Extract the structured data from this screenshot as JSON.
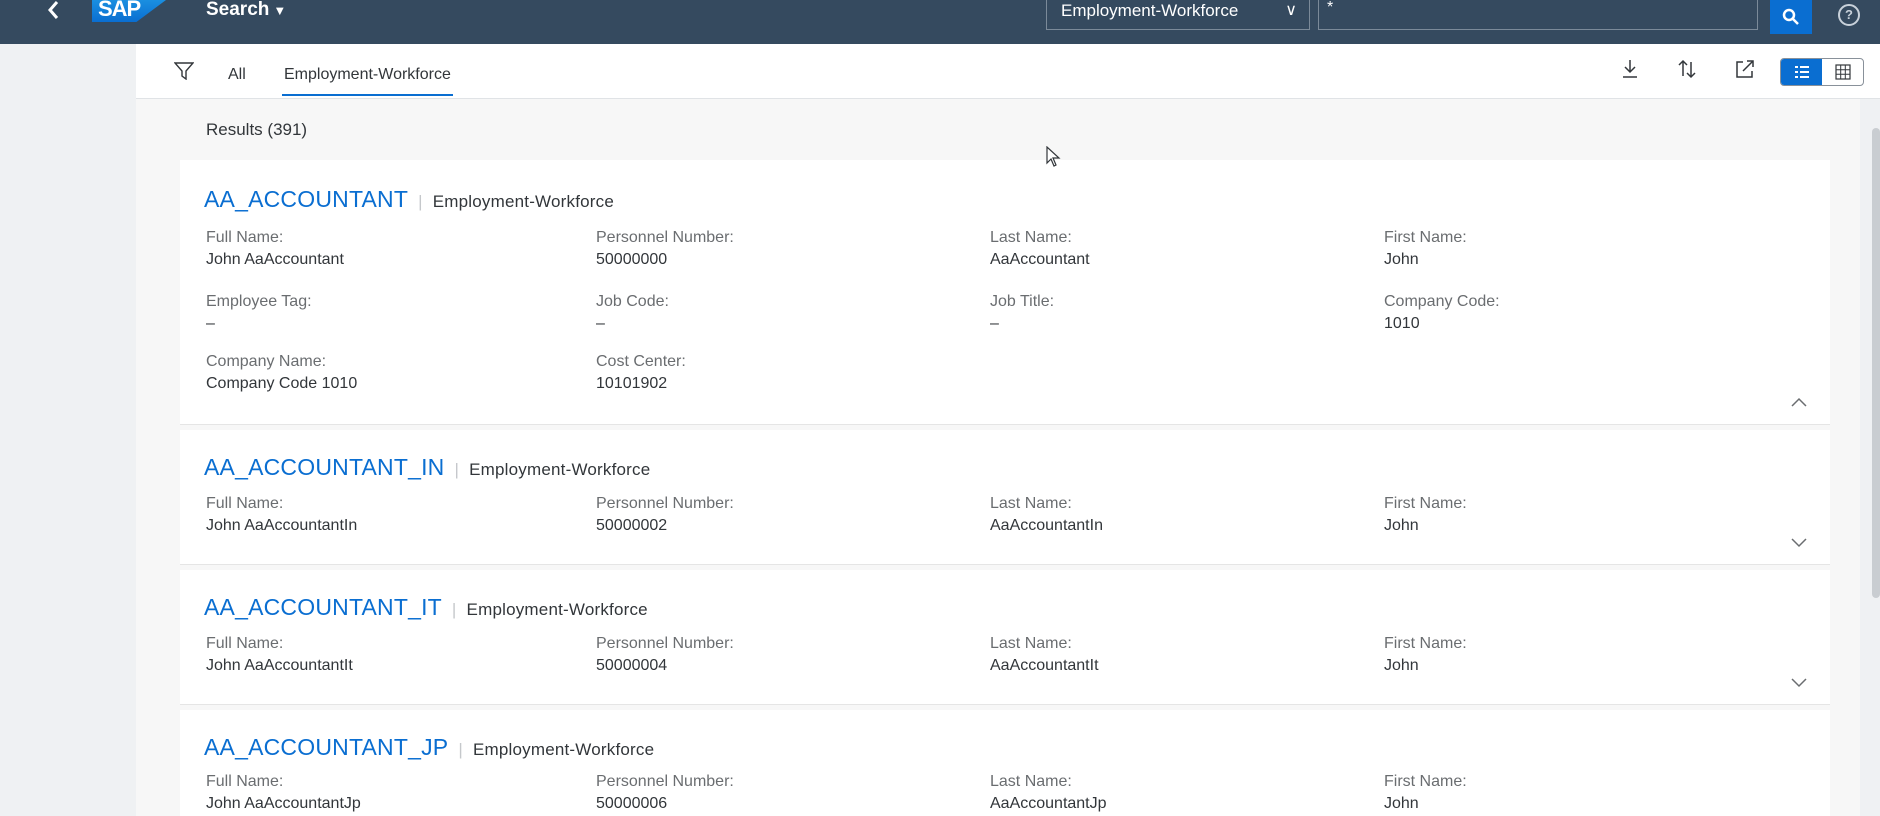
{
  "shell": {
    "logo": "SAP",
    "search_label": "Search",
    "scope": "Employment-Workforce",
    "search_value": "*",
    "help": "?"
  },
  "tabs": [
    {
      "label": "All"
    },
    {
      "label": "Employment-Workforce"
    }
  ],
  "results_count": "Results (391)",
  "labels": {
    "full_name": "Full Name:",
    "personnel_number": "Personnel Number:",
    "last_name": "Last Name:",
    "first_name": "First Name:",
    "employee_tag": "Employee Tag:",
    "job_code": "Job Code:",
    "job_title": "Job Title:",
    "company_code": "Company Code:",
    "company_name": "Company Name:",
    "cost_center": "Cost Center:"
  },
  "results": [
    {
      "title": "AA_ACCOUNTANT",
      "type": "Employment-Workforce",
      "full_name": "John AaAccountant",
      "personnel_number": "50000000",
      "last_name": "AaAccountant",
      "first_name": "John",
      "employee_tag": "–",
      "job_code": "–",
      "job_title": "–",
      "company_code": "1010",
      "company_name": "Company Code 1010",
      "cost_center": "10101902",
      "expanded": true
    },
    {
      "title": "AA_ACCOUNTANT_IN",
      "type": "Employment-Workforce",
      "full_name": "John AaAccountantIn",
      "personnel_number": "50000002",
      "last_name": "AaAccountantIn",
      "first_name": "John",
      "expanded": false
    },
    {
      "title": "AA_ACCOUNTANT_IT",
      "type": "Employment-Workforce",
      "full_name": "John AaAccountantIt",
      "personnel_number": "50000004",
      "last_name": "AaAccountantIt",
      "first_name": "John",
      "expanded": false
    },
    {
      "title": "AA_ACCOUNTANT_JP",
      "type": "Employment-Workforce",
      "full_name": "John AaAccountantJp",
      "personnel_number": "50000006",
      "last_name": "AaAccountantJp",
      "first_name": "John",
      "expanded": false
    }
  ],
  "icons": {
    "back": "chevron-left-icon",
    "search": "magnifier-icon",
    "filter": "funnel-icon",
    "download": "download-icon",
    "sort": "sort-icon",
    "share": "share-icon",
    "list_view": "list-view-icon",
    "grid_view": "grid-view-icon"
  },
  "colors": {
    "shell": "#354a5f",
    "accent": "#0a6ed1",
    "background": "#eff1f3"
  }
}
